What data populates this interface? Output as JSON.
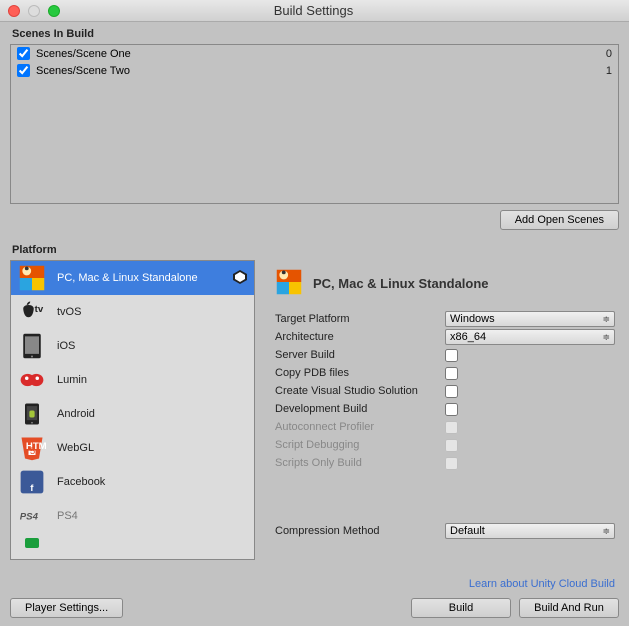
{
  "window": {
    "title": "Build Settings"
  },
  "scenes_header": "Scenes In Build",
  "scenes": [
    {
      "checked": true,
      "path": "Scenes/Scene One",
      "index": "0"
    },
    {
      "checked": true,
      "path": "Scenes/Scene Two",
      "index": "1"
    }
  ],
  "add_open_scenes": "Add Open Scenes",
  "platform_header": "Platform",
  "platforms": [
    {
      "id": "standalone",
      "label": "PC, Mac & Linux Standalone",
      "selected": true
    },
    {
      "id": "tvos",
      "label": "tvOS"
    },
    {
      "id": "ios",
      "label": "iOS"
    },
    {
      "id": "lumin",
      "label": "Lumin"
    },
    {
      "id": "android",
      "label": "Android"
    },
    {
      "id": "webgl",
      "label": "WebGL"
    },
    {
      "id": "facebook",
      "label": "Facebook"
    },
    {
      "id": "ps4",
      "label": "PS4",
      "dim": true
    }
  ],
  "details": {
    "header": "PC, Mac & Linux Standalone",
    "target_platform_label": "Target Platform",
    "target_platform_value": "Windows",
    "architecture_label": "Architecture",
    "architecture_value": "x86_64",
    "server_build_label": "Server Build",
    "copy_pdb_label": "Copy PDB files",
    "create_vs_label": "Create Visual Studio Solution",
    "dev_build_label": "Development Build",
    "autoconnect_label": "Autoconnect Profiler",
    "script_debug_label": "Script Debugging",
    "scripts_only_label": "Scripts Only Build",
    "compression_label": "Compression Method",
    "compression_value": "Default"
  },
  "link": "Learn about Unity Cloud Build",
  "buttons": {
    "player_settings": "Player Settings...",
    "build": "Build",
    "build_and_run": "Build And Run"
  }
}
